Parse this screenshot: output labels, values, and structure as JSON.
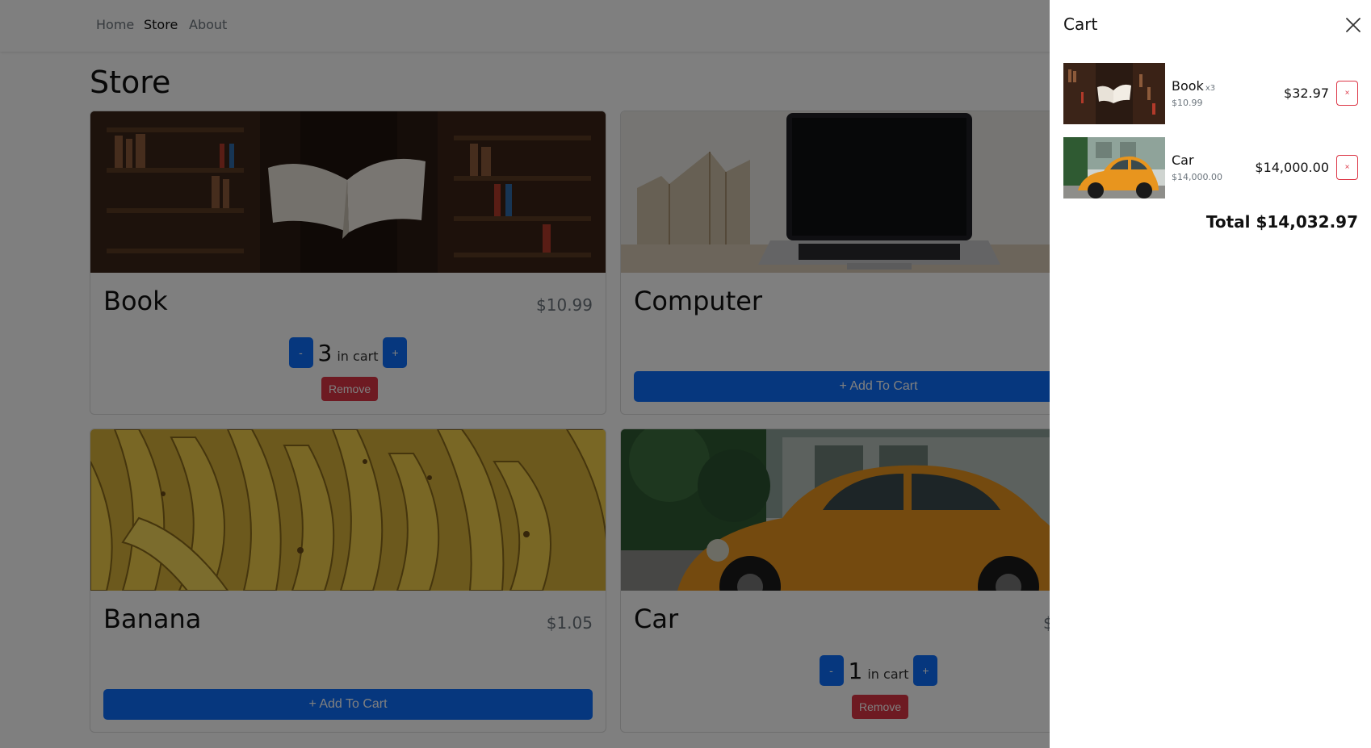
{
  "nav": {
    "links": [
      {
        "label": "Home"
      },
      {
        "label": "Store"
      },
      {
        "label": "About"
      }
    ]
  },
  "store": {
    "title": "Store",
    "products": [
      {
        "name": "Book",
        "price": "$10.99",
        "quantity": "3",
        "in_cart_label": "in cart",
        "minus_label": "-",
        "plus_label": "+",
        "remove_label": "Remove"
      },
      {
        "name": "Computer",
        "add_label": "+ Add To Cart"
      },
      {
        "name": "Banana",
        "price": "$1.05",
        "add_label": "+ Add To Cart"
      },
      {
        "name": "Car",
        "price": "$",
        "quantity": "1",
        "in_cart_label": "in cart",
        "minus_label": "-",
        "plus_label": "+",
        "remove_label": "Remove"
      }
    ]
  },
  "cart": {
    "title": "Cart",
    "close_icon": "close-icon",
    "items": [
      {
        "name": "Book",
        "multiplier": "x3",
        "unit_price": "$10.99",
        "line_total": "$32.97",
        "remove_label": "×"
      },
      {
        "name": "Car",
        "multiplier": "",
        "unit_price": "$14,000.00",
        "line_total": "$14,000.00",
        "remove_label": "×"
      }
    ],
    "total": "Total $14,032.97"
  },
  "colors": {
    "primary": "#0d6efd",
    "danger": "#dc3545",
    "overlay": "rgba(0,0,0,0.5)"
  }
}
